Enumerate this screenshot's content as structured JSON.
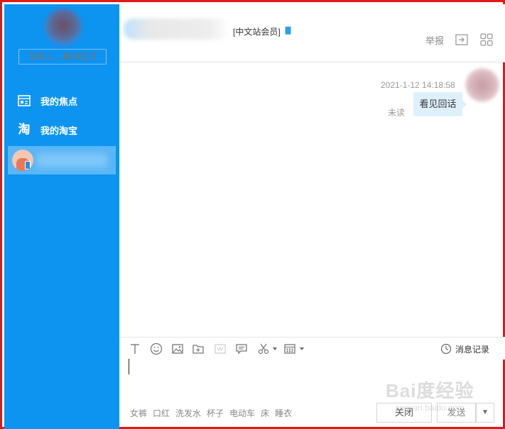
{
  "sidebar": {
    "search_placeholder": "联系人、群和宝贝",
    "nav": [
      {
        "label": "我的焦点",
        "icon": "focus-icon"
      },
      {
        "label": "我的淘宝",
        "icon": "taobao-icon"
      }
    ],
    "colors": {
      "background": "#0d93f0",
      "selected": "#5ab6f6"
    }
  },
  "header": {
    "member_tag": "[中文站会员]",
    "report_label": "举报",
    "icons": [
      "exit-icon",
      "apps-grid-icon"
    ]
  },
  "chat": {
    "messages": [
      {
        "time": "2021-1-12 14:18:58",
        "text": "看见回话",
        "status": "未读"
      }
    ]
  },
  "toolbar": {
    "icons": [
      "font-icon",
      "emoji-icon",
      "image-icon",
      "folder-icon",
      "video-icon",
      "comment-icon",
      "scissors-icon",
      "keyboard-icon"
    ],
    "history_label": "消息记录"
  },
  "quick_phrases": [
    "女裤",
    "口红",
    "洗发水",
    "杯子",
    "电动车",
    "床",
    "睡衣"
  ],
  "buttons": {
    "close_label": "关闭",
    "send_label": "发送",
    "send_menu": "▼"
  },
  "watermark": {
    "brand": "Bai度经验",
    "url": "jingyan.baidu.com"
  }
}
